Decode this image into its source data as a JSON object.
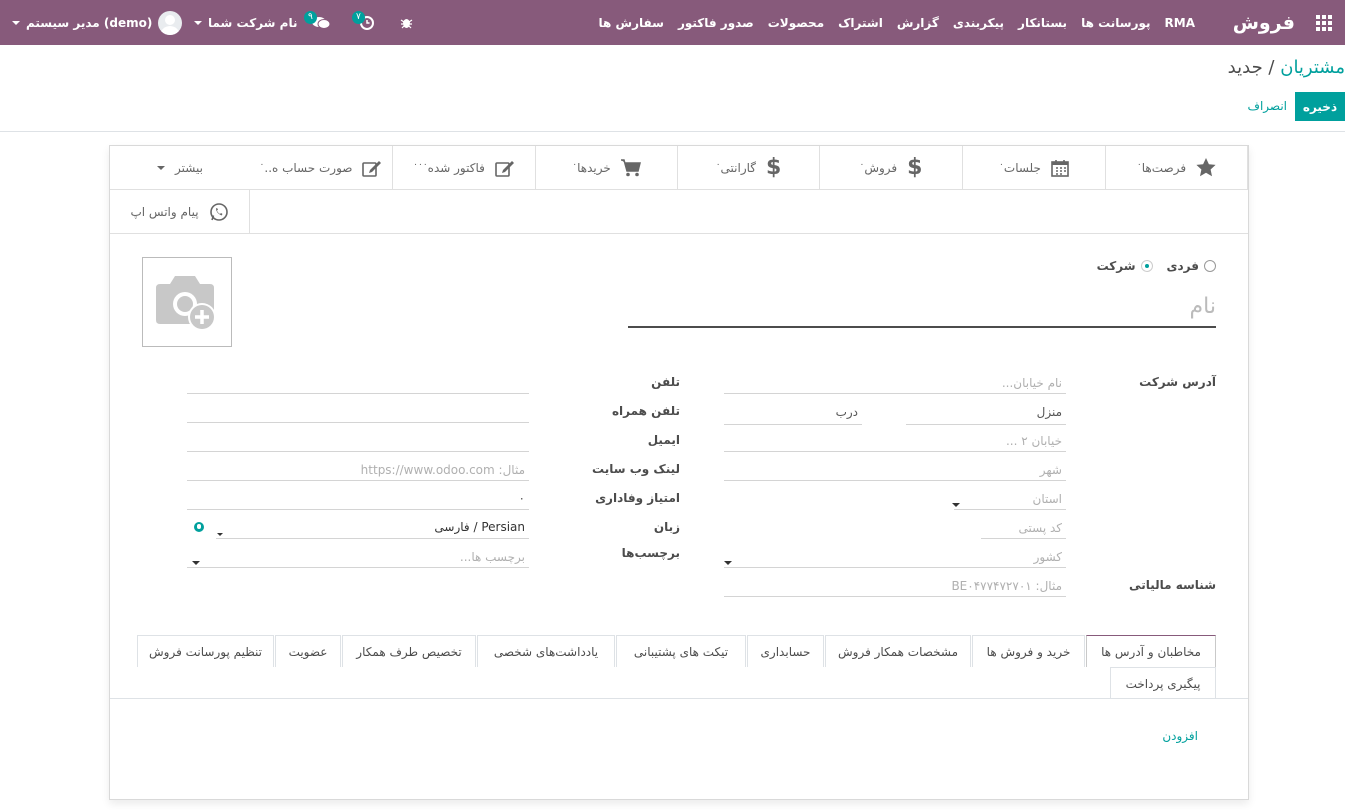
{
  "navbar": {
    "brand": "فروش",
    "menu": [
      "سفارش ها",
      "صدور فاکتور",
      "محصولات",
      "اشتراک",
      "گزارش",
      "پیکربندی",
      "بستانکار",
      "پورسانت ها",
      "RMA"
    ],
    "activity_count": "۷",
    "message_count": "۹",
    "company": "نام شرکت شما",
    "user": "مدیر سیستم (demo)"
  },
  "breadcrumb": {
    "parent": "مشتریان",
    "separator": " / ",
    "current": "جدید"
  },
  "buttons": {
    "save": "ذخیره",
    "discard": "انصراف"
  },
  "smart_buttons": {
    "row1": [
      {
        "label": "فرصت‌ها",
        "icon": "star-icon",
        "value": "۰"
      },
      {
        "label": "جلسات",
        "icon": "calendar-icon",
        "value": "۰"
      },
      {
        "label": "فروش",
        "icon": "dollar-icon",
        "value": "۰"
      },
      {
        "label": "گارانتی",
        "icon": "dollar-icon",
        "value": "۰"
      },
      {
        "label": "خریدها",
        "icon": "cart-icon",
        "value": "۰"
      },
      {
        "label": "فاکتور شده",
        "icon": "edit-icon",
        "value": "۰۰۰"
      },
      {
        "label": "صورت حساب ه..",
        "icon": "edit-icon",
        "value": "۰"
      },
      {
        "label": "بیشتر",
        "icon": "caret-down-icon"
      }
    ],
    "row2": [
      {
        "label": "پیام واتس اپ",
        "icon": "whatsapp-icon"
      }
    ]
  },
  "company_type": {
    "options": [
      "فردی",
      "شرکت"
    ],
    "selected": "شرکت"
  },
  "name_placeholder": "نام",
  "address": {
    "label": "آدرس شرکت",
    "street_placeholder": "نام خیابان...",
    "street2_placeholder": "خیابان ۲ ...",
    "house_label": "منزل",
    "door_label": "درب",
    "city_placeholder": "شهر",
    "state_placeholder": "استان",
    "zip_placeholder": "کد پستی",
    "country_placeholder": "کشور"
  },
  "vat": {
    "label": "شناسه مالیاتی",
    "placeholder": "مثال: BE۰۴۷۷۴۷۲۷۰۱"
  },
  "right_fields": {
    "phone_label": "تلفن",
    "mobile_label": "تلفن همراه",
    "email_label": "ایمیل",
    "website_label": "لینک وب سایت",
    "website_placeholder": "مثال: https://www.odoo.com",
    "loyalty_label": "امتیاز وفاداری",
    "loyalty_value": "۰",
    "lang_label": "زبان",
    "lang_value": "Persian / فارسی",
    "tags_label": "برچسب‌ها",
    "tags_placeholder": "برچسب ها..."
  },
  "tabs": {
    "row1": [
      "مخاطبان و آدرس ها",
      "خرید و فروش ها",
      "مشخصات همکار فروش",
      "حسابداری",
      "تیکت های پشتیبانی",
      "یادداشت‌های شخصی",
      "تخصیص طرف همکار",
      "عضویت",
      "تنظیم پورسانت فروش"
    ],
    "row2": [
      "پیگیری پرداخت"
    ],
    "active": "مخاطبان و آدرس ها"
  },
  "add_link": "افزودن",
  "colors": {
    "primary": "#875a7b",
    "accent": "#00a09d"
  }
}
